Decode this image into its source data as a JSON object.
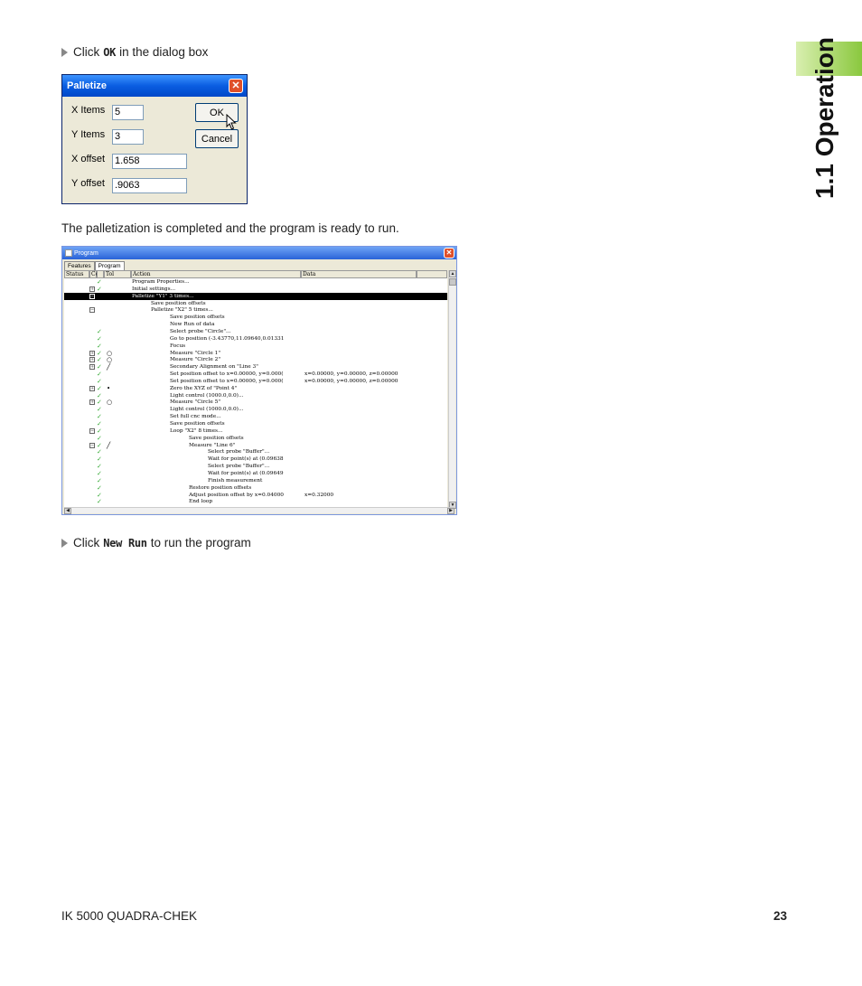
{
  "instructions": {
    "step1": {
      "prefix": "Click",
      "keyword": "OK",
      "suffix": "in the dialog box"
    },
    "para": "The palletization is completed and the program is ready to run.",
    "step2": {
      "prefix": "Click",
      "keyword": "New Run",
      "suffix": "to run the program"
    }
  },
  "sidebar": {
    "title": "1.1 Operation"
  },
  "footer": {
    "product": "IK 5000 QUADRA-CHEK",
    "page": "23"
  },
  "palletize_dialog": {
    "title": "Palletize",
    "close_glyph": "✕",
    "fields": [
      {
        "label": "X Items",
        "value": "5"
      },
      {
        "label": "Y Items",
        "value": "3"
      },
      {
        "label": "X offset",
        "value": "1.658"
      },
      {
        "label": "Y offset",
        "value": ".9063"
      }
    ],
    "ok_label": "OK",
    "cancel_label": "Cancel"
  },
  "program_window": {
    "title": "Program",
    "close_glyph": "✕",
    "tabs": [
      "Features",
      "Program"
    ],
    "columns": [
      "Status",
      "Co",
      "Tol",
      "Action",
      "Data"
    ],
    "rows": [
      {
        "exp": "",
        "check": true,
        "sym": "",
        "level": 0,
        "action": "Program Properties...",
        "data": ""
      },
      {
        "exp": "+",
        "check": true,
        "sym": "",
        "level": 0,
        "action": "Initial settings...",
        "data": ""
      },
      {
        "exp": "-",
        "check": false,
        "sym": "",
        "level": 0,
        "action": "Palletize \"Y1\" 3 times...",
        "data": "",
        "selected": true
      },
      {
        "exp": "",
        "check": false,
        "sym": "",
        "level": 1,
        "action": "Save position offsets",
        "data": ""
      },
      {
        "exp": "-",
        "check": false,
        "sym": "",
        "level": 1,
        "action": "Palletize \"X2\" 5 times...",
        "data": ""
      },
      {
        "exp": "",
        "check": false,
        "sym": "",
        "level": 2,
        "action": "Save position offsets",
        "data": ""
      },
      {
        "exp": "",
        "check": false,
        "sym": "",
        "level": 2,
        "action": "New Run of data",
        "data": ""
      },
      {
        "exp": "",
        "check": true,
        "sym": "",
        "level": 2,
        "action": "Select probe \"Circle\"...",
        "data": ""
      },
      {
        "exp": "",
        "check": true,
        "sym": "",
        "level": 2,
        "action": "Go to position (-3.43770,11.09640,0.01331",
        "data": ""
      },
      {
        "exp": "",
        "check": true,
        "sym": "",
        "level": 2,
        "action": "Focus",
        "data": ""
      },
      {
        "exp": "+",
        "check": true,
        "sym": "○",
        "level": 2,
        "action": "Measure \"Circle 1\"",
        "data": ""
      },
      {
        "exp": "+",
        "check": true,
        "sym": "○",
        "level": 2,
        "action": "Measure \"Circle 2\"",
        "data": ""
      },
      {
        "exp": "+",
        "check": true,
        "sym": "╱",
        "level": 2,
        "action": "Secondary Alignment on \"Line 3\"",
        "data": ""
      },
      {
        "exp": "",
        "check": true,
        "sym": "",
        "level": 2,
        "action": "Set position offset to x=0.00000, y=0.000(",
        "data": "x=0.00000, y=0.00000, z=0.00000"
      },
      {
        "exp": "",
        "check": true,
        "sym": "",
        "level": 2,
        "action": "Set position offset to x=0.00000, y=0.000(",
        "data": "x=0.00000, y=0.00000, z=0.00000"
      },
      {
        "exp": "+",
        "check": true,
        "sym": "•",
        "level": 2,
        "action": "Zero the XYZ of \"Point 4\"",
        "data": ""
      },
      {
        "exp": "",
        "check": true,
        "sym": "",
        "level": 2,
        "action": "Light control (1000.0,0.0)...",
        "data": ""
      },
      {
        "exp": "+",
        "check": true,
        "sym": "○",
        "level": 2,
        "action": "Measure \"Circle 5\"",
        "data": ""
      },
      {
        "exp": "",
        "check": true,
        "sym": "",
        "level": 2,
        "action": "Light control (1000.0,0.0)...",
        "data": ""
      },
      {
        "exp": "",
        "check": true,
        "sym": "",
        "level": 2,
        "action": "Set full cnc mode...",
        "data": ""
      },
      {
        "exp": "",
        "check": true,
        "sym": "",
        "level": 2,
        "action": "Save position offsets",
        "data": ""
      },
      {
        "exp": "-",
        "check": true,
        "sym": "",
        "level": 2,
        "action": "Loop \"X2\" 8 times...",
        "data": ""
      },
      {
        "exp": "",
        "check": true,
        "sym": "",
        "level": 3,
        "action": "Save position offsets",
        "data": ""
      },
      {
        "exp": "-",
        "check": true,
        "sym": "╱",
        "level": 3,
        "action": "Measure \"Line 6\"",
        "data": ""
      },
      {
        "exp": "",
        "check": true,
        "sym": "",
        "level": 4,
        "action": "Select probe \"Buffer\"...",
        "data": ""
      },
      {
        "exp": "",
        "check": true,
        "sym": "",
        "level": 4,
        "action": "Wait for point(s) at (0.09638",
        "data": ""
      },
      {
        "exp": "",
        "check": true,
        "sym": "",
        "level": 4,
        "action": "Select probe \"Buffer\"...",
        "data": ""
      },
      {
        "exp": "",
        "check": true,
        "sym": "",
        "level": 4,
        "action": "Wait for point(s) at (0.09649",
        "data": ""
      },
      {
        "exp": "",
        "check": true,
        "sym": "",
        "level": 4,
        "action": "Finish measurement",
        "data": ""
      },
      {
        "exp": "",
        "check": true,
        "sym": "",
        "level": 3,
        "action": "Restore position offsets",
        "data": ""
      },
      {
        "exp": "",
        "check": true,
        "sym": "",
        "level": 3,
        "action": "Adjust position offset by x=0.04000",
        "data": "x=0.32000"
      },
      {
        "exp": "",
        "check": true,
        "sym": "",
        "level": 3,
        "action": "End loop",
        "data": ""
      }
    ]
  }
}
